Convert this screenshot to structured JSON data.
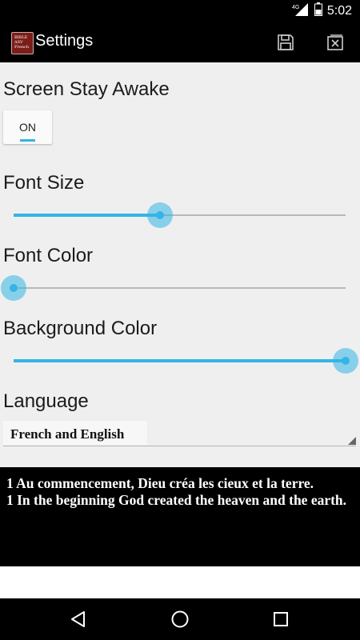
{
  "status_bar": {
    "network_label": "4G",
    "time": "5:02",
    "icons": [
      "signal-icon",
      "battery-icon"
    ]
  },
  "app_bar": {
    "title": "Settings",
    "app_icon_text": "BIBLE ASV French",
    "actions": [
      "save-icon",
      "close-icon"
    ]
  },
  "settings": {
    "screen_awake": {
      "label": "Screen Stay Awake",
      "value": "ON"
    },
    "font_size": {
      "label": "Font Size",
      "value_fraction": 0.44
    },
    "font_color": {
      "label": "Font Color",
      "value_fraction": 0.0
    },
    "background_color": {
      "label": "Background Color",
      "value_fraction": 1.0
    },
    "language": {
      "label": "Language",
      "selected": "French and English"
    }
  },
  "preview": {
    "line_french": "1 Au commencement, Dieu créa les cieux et la terre.",
    "line_english": "1 In the beginning God created the heaven and the earth."
  },
  "colors": {
    "accent": "#33b5e5",
    "background": "#efefef",
    "bars": "#000000"
  },
  "nav_bar": {
    "icons": [
      "back-icon",
      "home-icon",
      "recents-icon"
    ]
  }
}
